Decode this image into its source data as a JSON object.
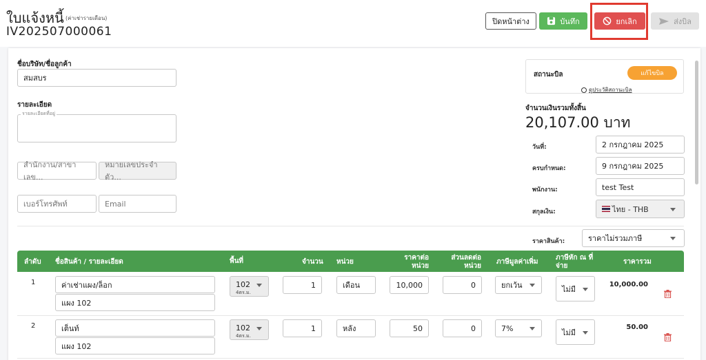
{
  "header": {
    "title": "ใบแจ้งหนี้",
    "subtitle": "(ค่าเช่ารายเดือน)",
    "doc_number": "IV202507000061",
    "buttons": {
      "close": "ปิดหน้าต่าง",
      "save": "บันทึก",
      "cancel": "ยกเลิก",
      "send": "ส่งบิล"
    }
  },
  "customer": {
    "label": "ชื่อบริษัท/ชื่อลูกค้า",
    "value": "สมสบร"
  },
  "details": {
    "label": "รายละเอียด",
    "address_legend": "รายละเอียดที่อยู่",
    "branch_placeholder": "สำนักงาน/สาขาเลข...",
    "tax_id_placeholder": "หมายเลขประจำตัว...",
    "phone_placeholder": "เบอร์โทรศัพท์",
    "email_placeholder": "Email"
  },
  "status": {
    "label": "สถานะบิล",
    "button": "แก้ไขบิล",
    "history_link": "ดูประวัติสถานะบิล"
  },
  "total": {
    "label": "จำนวนเงินรวมทั้งสิ้น",
    "amount": "20,107.00 บาท"
  },
  "meta": {
    "date_label": "วันที่:",
    "date_value": "2 กรกฎาคม 2025",
    "due_label": "ครบกำหนด:",
    "due_value": "9 กรกฎาคม 2025",
    "staff_label": "พนักงาน:",
    "staff_value": "test Test",
    "currency_label": "สกุลเงิน:",
    "currency_value": "ไทย - THB",
    "price_label": "ราคาสินค้า:",
    "price_value": "ราคาไม่รวมภาษี"
  },
  "table": {
    "headers": {
      "index": "ลำดับ",
      "product": "ชื่อสินค้า / รายละเอียด",
      "area": "พื้นที่",
      "qty": "จำนวน",
      "unit": "หน่วย",
      "price_1": "ราคาต่อ",
      "price_2": "หน่วย",
      "discount_1": "ส่วนลดต่อ",
      "discount_2": "หน่วย",
      "vat": "ภาษีมูลค่าเพิ่ม",
      "wht_1": "ภาษีหัก ณ ที่",
      "wht_2": "จ่าย",
      "total": "ราคารวม"
    },
    "rows": [
      {
        "index": "1",
        "name": "ค่าเช่าแผง/ล็อก",
        "detail": "แผง 102",
        "area_main": "102",
        "area_sub": "4ตร.ม.",
        "qty": "1",
        "unit": "เดือน",
        "price": "10,000",
        "discount": "0",
        "vat": "ยกเว้น",
        "wht": "ไม่มี",
        "total": "10,000.00"
      },
      {
        "index": "2",
        "name": "เต็นท์",
        "detail": "แผง 102",
        "area_main": "102",
        "area_sub": "4ตร.ม.",
        "qty": "1",
        "unit": "หลัง",
        "price": "50",
        "discount": "0",
        "vat": "7%",
        "wht": "ไม่มี",
        "total": "50.00"
      }
    ]
  },
  "icons": {
    "save": "floppy-disk-icon",
    "cancel": "ban-icon",
    "send": "paper-plane-icon",
    "history": "clock-icon",
    "flag": "thai-flag-icon",
    "delete": "trash-icon"
  },
  "colors": {
    "primary_green": "#4a9d4e",
    "save_green": "#5cb85c",
    "cancel_red": "#e05050",
    "status_orange": "#f7a233",
    "highlight_red": "#e03a2f",
    "delete_red": "#d9534f"
  }
}
